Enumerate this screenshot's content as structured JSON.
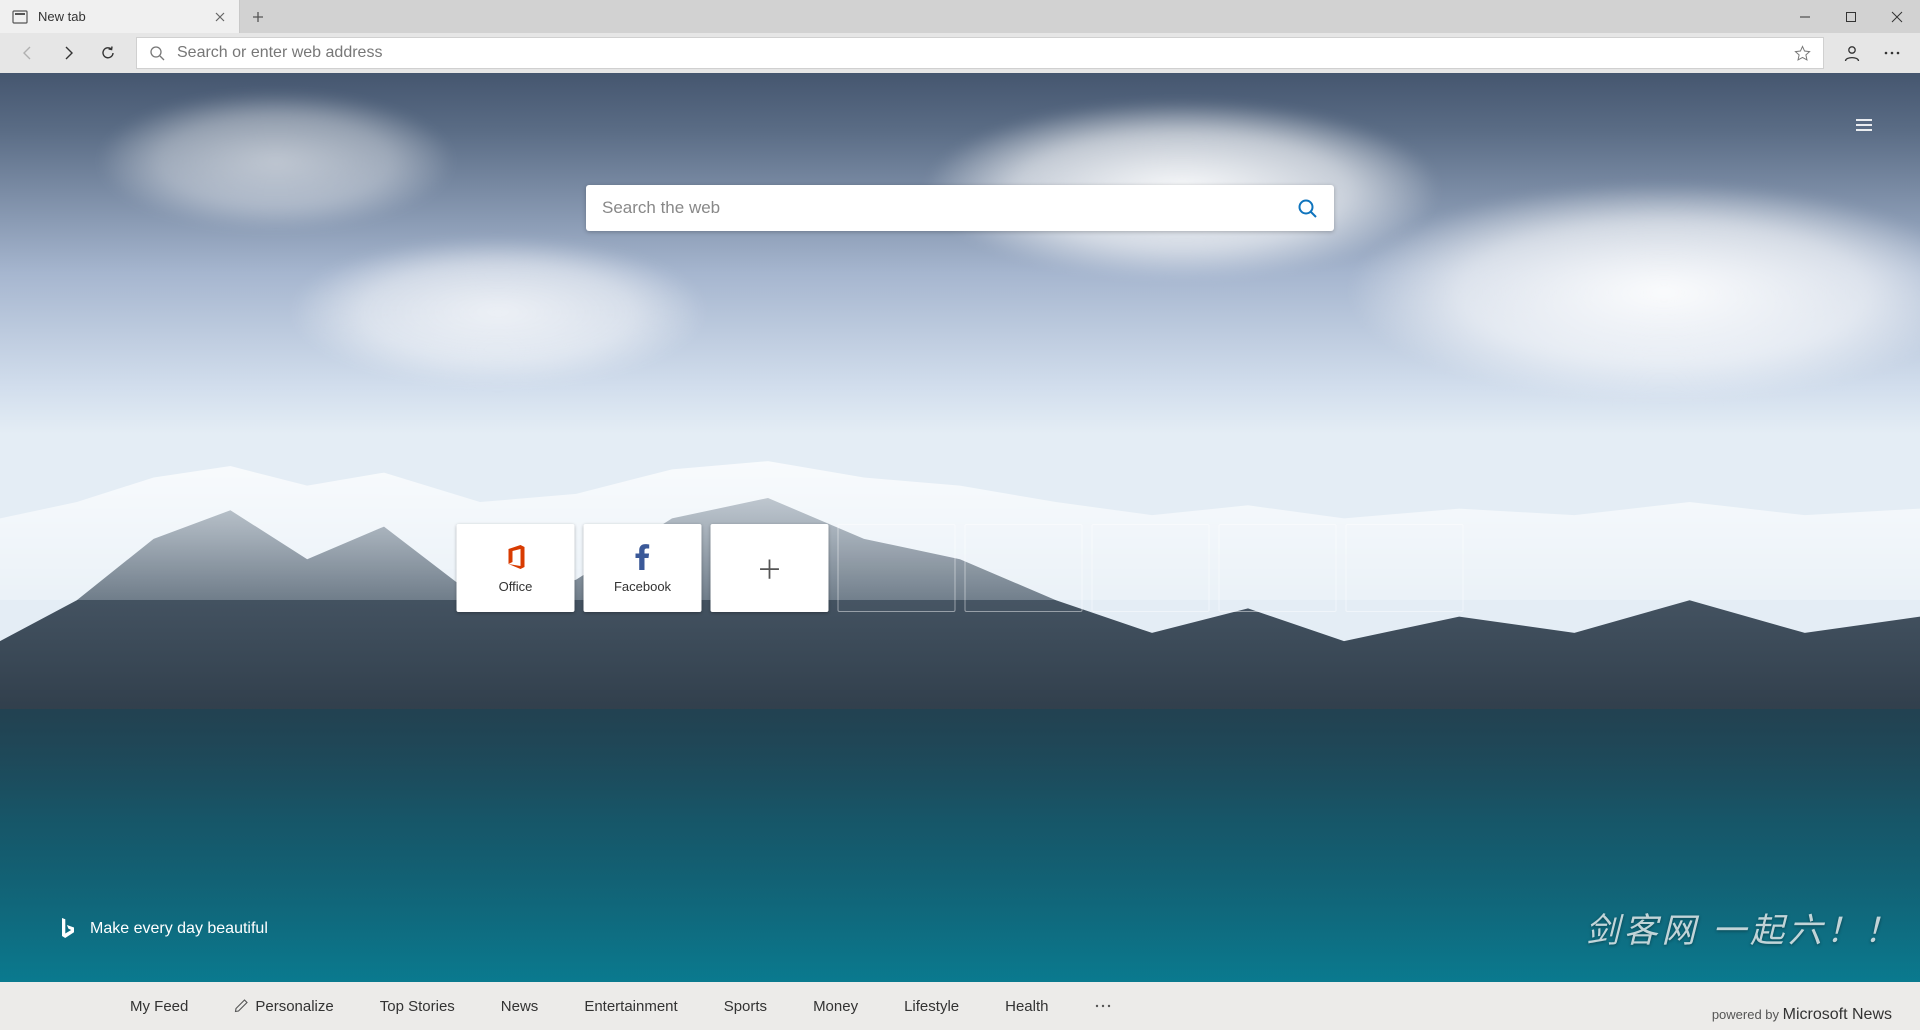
{
  "tab": {
    "title": "New tab"
  },
  "toolbar": {
    "address_placeholder": "Search or enter web address"
  },
  "page": {
    "search_placeholder": "Search the web",
    "tiles": [
      {
        "label": "Office"
      },
      {
        "label": "Facebook"
      }
    ],
    "bing_tagline": "Make every day beautiful",
    "watermark": "剑客网  一起六！！"
  },
  "footer": {
    "items": [
      "My Feed",
      "Personalize",
      "Top Stories",
      "News",
      "Entertainment",
      "Sports",
      "Money",
      "Lifestyle",
      "Health"
    ],
    "powered_by_prefix": "powered by ",
    "powered_by_brand": "Microsoft News"
  }
}
